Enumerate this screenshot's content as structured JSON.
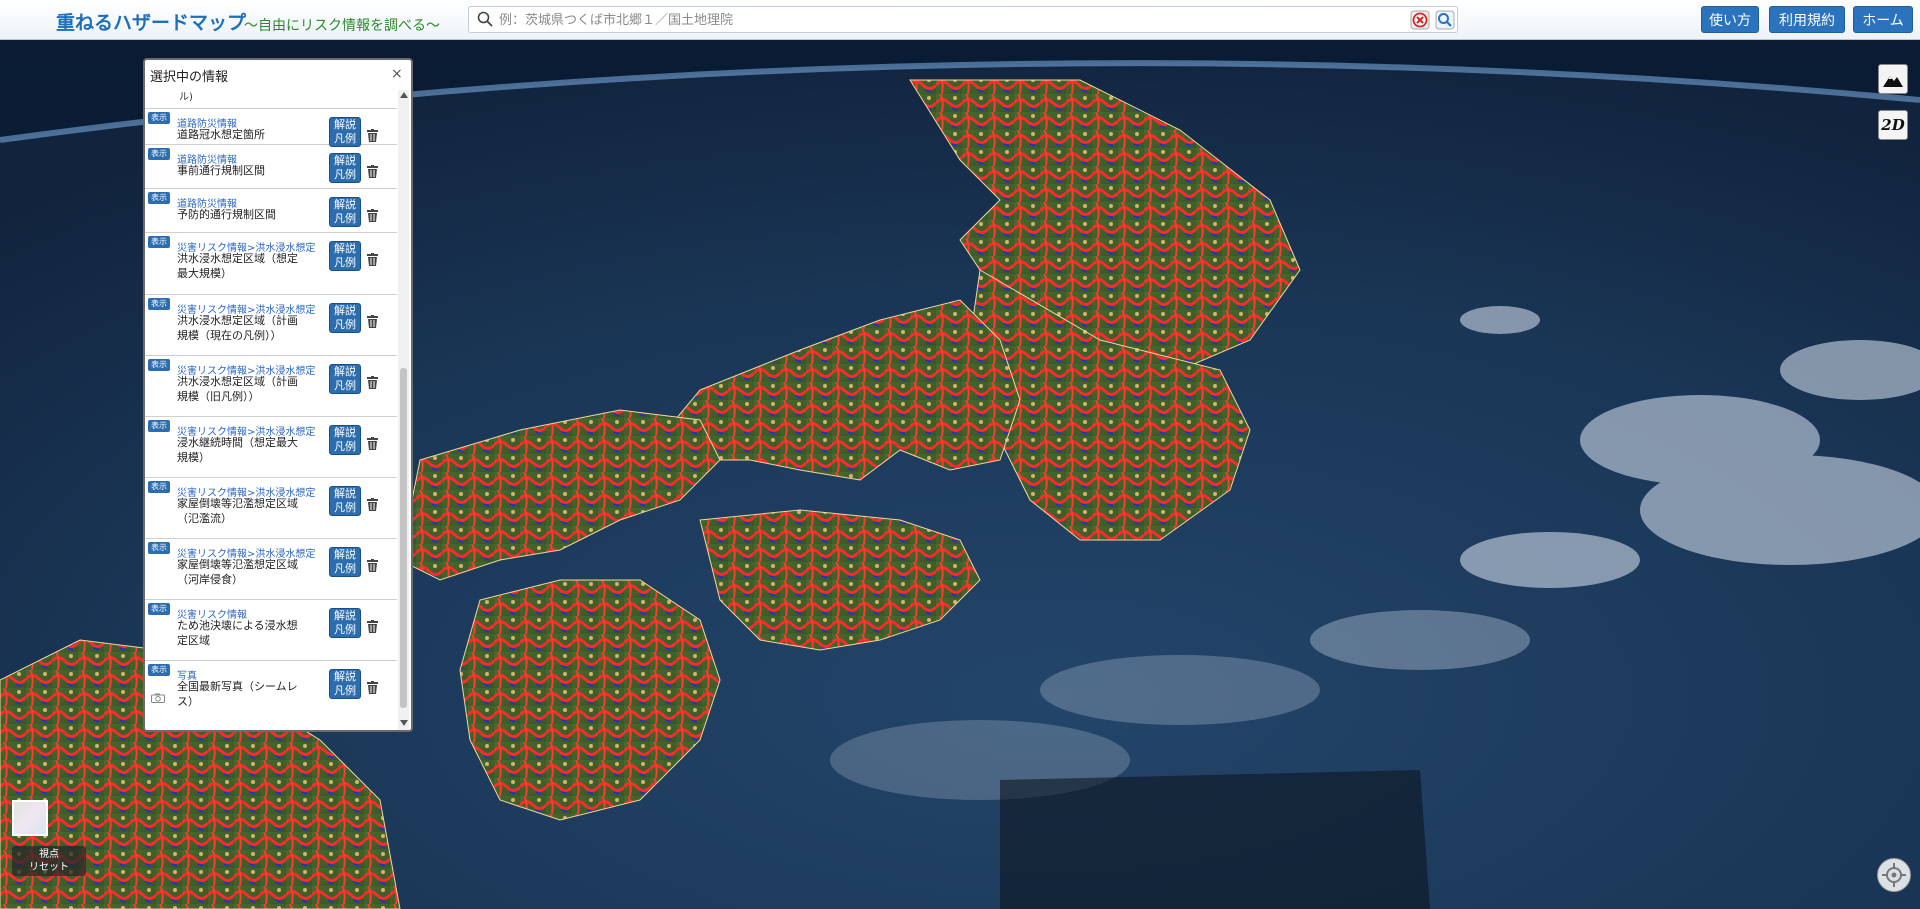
{
  "header": {
    "title": "重ねるハザードマップ",
    "tagline": "～自由にリスク情報を調べる～",
    "search_placeholder": "例：茨城県つくば市北郷１／国土地理院",
    "buttons": {
      "usage": "使い方",
      "terms": "利用規約",
      "home": "ホーム"
    }
  },
  "panel": {
    "title": "選択中の情報",
    "close": "×",
    "cut_text": "ル)",
    "show_label": "表示",
    "legend_label_1": "解説",
    "legend_label_2": "凡例",
    "layers": [
      {
        "category": "道路防災情報",
        "name": "道路冠水想定箇所"
      },
      {
        "category": "道路防災情報",
        "name": "事前通行規制区間"
      },
      {
        "category": "道路防災情報",
        "name": "予防的通行規制区間"
      },
      {
        "category": "災害リスク情報>洪水浸水想定",
        "name": "洪水浸水想定区域（想定最大規模）"
      },
      {
        "category": "災害リスク情報>洪水浸水想定",
        "name": "洪水浸水想定区域（計画規模（現在の凡例））"
      },
      {
        "category": "災害リスク情報>洪水浸水想定",
        "name": "洪水浸水想定区域（計画規模（旧凡例））"
      },
      {
        "category": "災害リスク情報>洪水浸水想定",
        "name": "浸水継続時間（想定最大規模）"
      },
      {
        "category": "災害リスク情報>洪水浸水想定",
        "name": "家屋倒壊等氾濫想定区域（氾濫流）"
      },
      {
        "category": "災害リスク情報>洪水浸水想定",
        "name": "家屋倒壊等氾濫想定区域（河岸侵食）"
      },
      {
        "category": "災害リスク情報",
        "name": "ため池決壊による浸水想定区域"
      },
      {
        "category": "写真",
        "name": "全国最新写真（シームレス）"
      }
    ]
  },
  "controls": {
    "mode_2d": "2D",
    "reset_line1": "視点",
    "reset_line2": "リセット"
  }
}
